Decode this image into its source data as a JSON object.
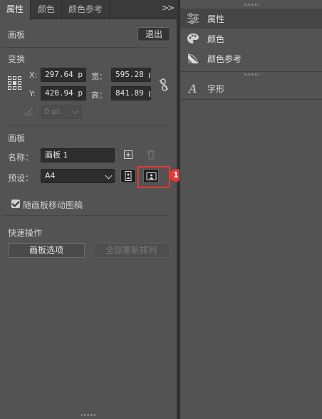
{
  "tabs": [
    {
      "label": "属性",
      "active": true
    },
    {
      "label": "颜色",
      "active": false
    },
    {
      "label": "颜色参考",
      "active": false
    }
  ],
  "overflow_icon": "double-chevron-right",
  "artboard_mode": {
    "title": "画板",
    "exit_label": "退出"
  },
  "transform": {
    "title": "变换",
    "x_label": "X:",
    "x_value": "297.64 p",
    "y_label": "Y:",
    "y_value": "420.94 p",
    "w_label": "宽：",
    "w_value": "595.28 p",
    "h_label": "高：",
    "h_value": "841.89 p",
    "angle_value": "0 pt"
  },
  "artboard": {
    "title": "画板",
    "name_label": "名称：",
    "name_value": "画板 1",
    "preset_label": "预设：",
    "preset_value": "A4",
    "callout_number": "1",
    "move_with_artboard_label": "随画板移动图稿",
    "move_with_artboard_checked": true
  },
  "quick_actions": {
    "title": "快速操作",
    "artboard_options_label": "画板选项",
    "rearrange_all_label": "全部重新排列"
  },
  "dock": {
    "items": [
      {
        "label": "属性",
        "icon": "sliders-icon",
        "active": true
      },
      {
        "label": "颜色",
        "icon": "palette-icon",
        "active": false
      },
      {
        "label": "颜色参考",
        "icon": "color-guide-icon",
        "active": false
      },
      {
        "label": "字形",
        "icon": "glyphs-icon",
        "active": false
      }
    ]
  },
  "colors": {
    "panel_bg": "#535353",
    "highlight": "#e53935"
  }
}
